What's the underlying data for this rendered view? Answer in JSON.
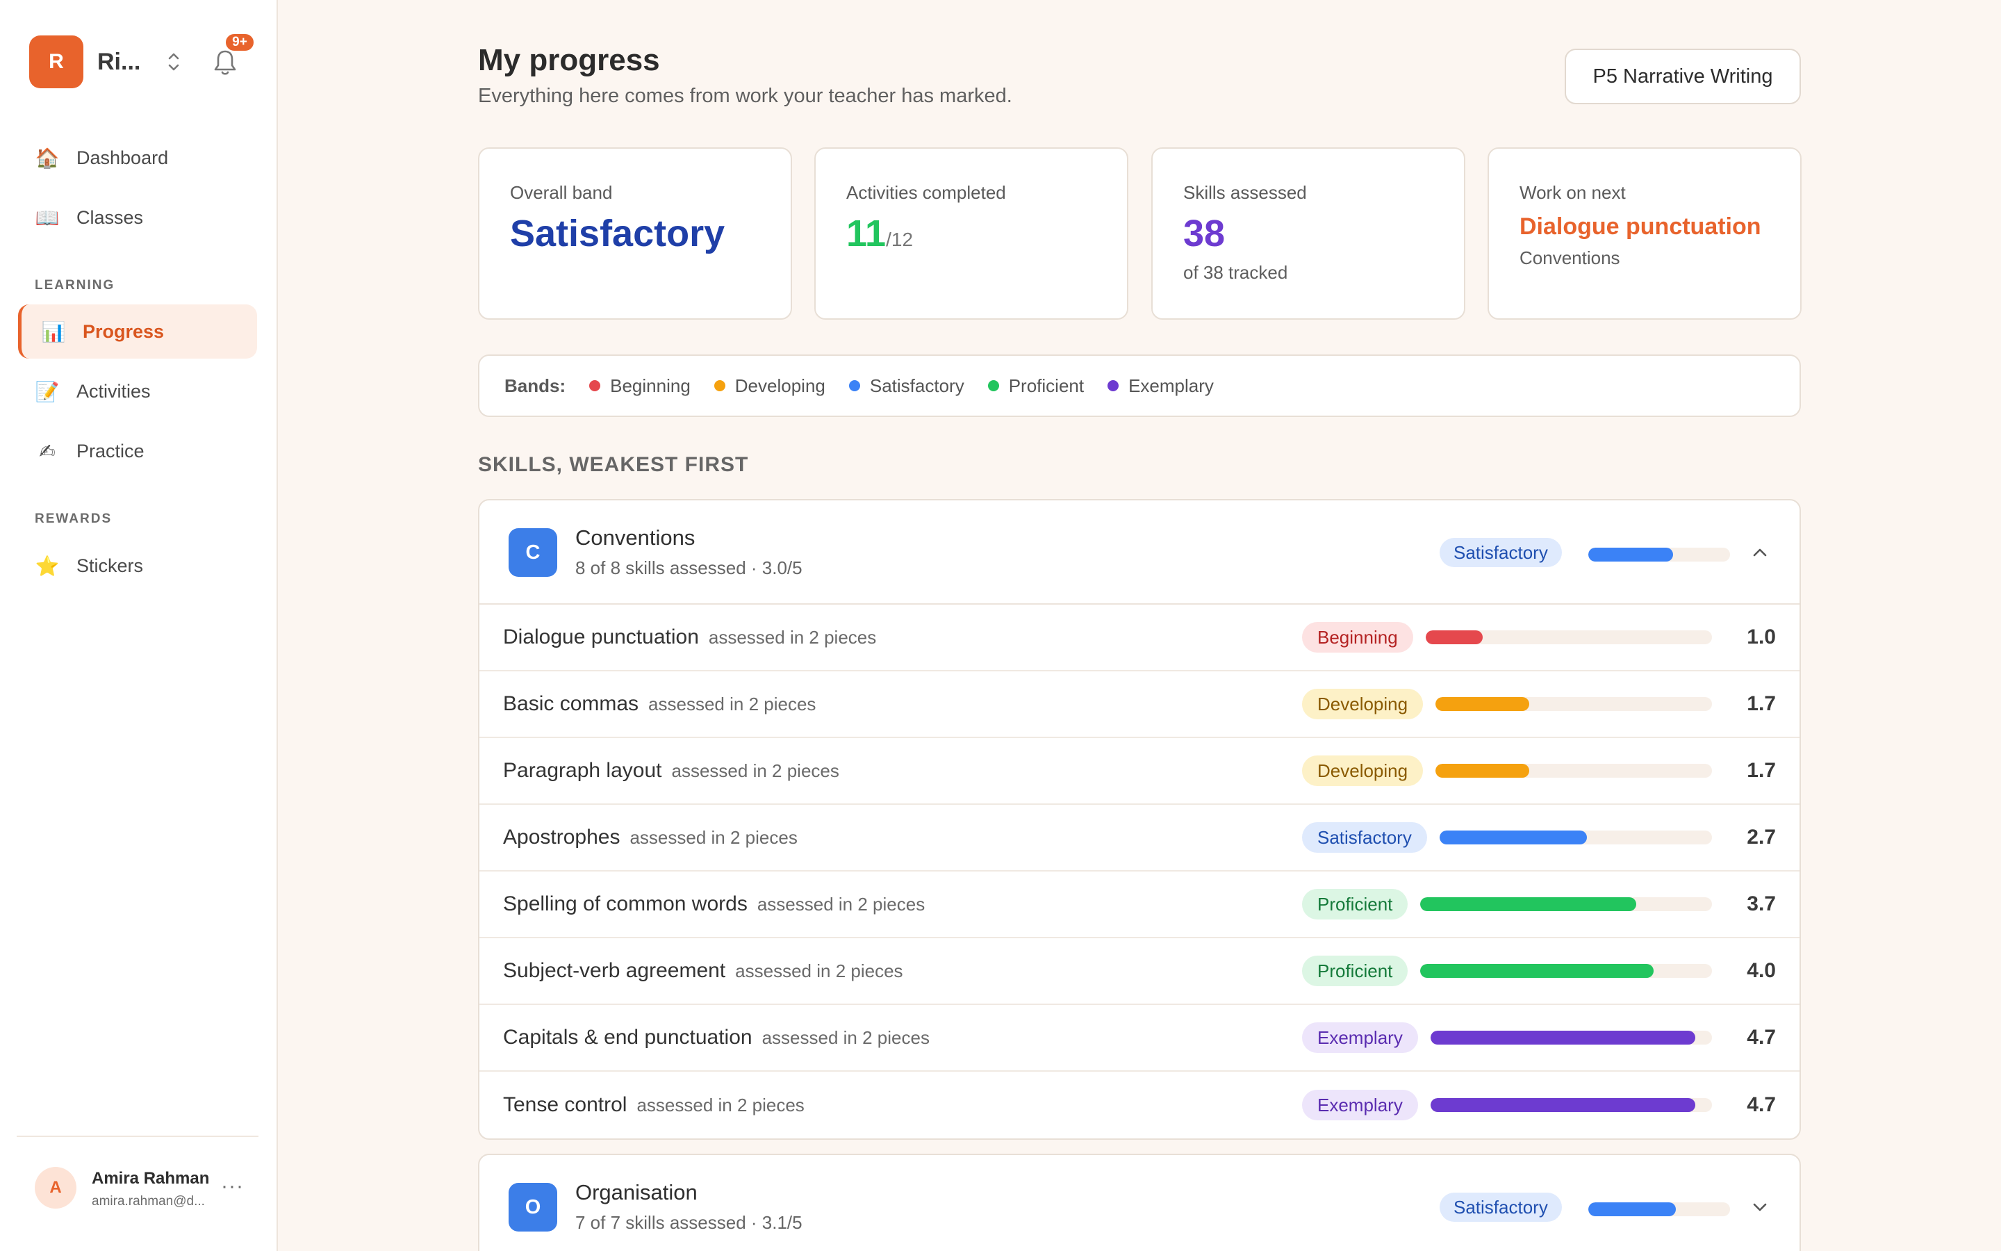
{
  "app": {
    "logo_letter": "R",
    "name": "Ri...",
    "notification_badge": "9+"
  },
  "nav": {
    "items": [
      {
        "label": "Dashboard",
        "icon": "🏠",
        "icon_name": "house-icon"
      },
      {
        "label": "Classes",
        "icon": "📖",
        "icon_name": "book-icon"
      }
    ],
    "learning_label": "LEARNING",
    "learning_items": [
      {
        "label": "Progress",
        "icon": "📊",
        "icon_name": "bar-chart-icon",
        "active": true
      },
      {
        "label": "Activities",
        "icon": "📝",
        "icon_name": "memo-icon"
      },
      {
        "label": "Practice",
        "icon": "✍",
        "icon_name": "writing-hand-icon"
      }
    ],
    "rewards_label": "REWARDS",
    "rewards_items": [
      {
        "label": "Stickers",
        "icon": "⭐",
        "icon_name": "star-icon"
      }
    ]
  },
  "user": {
    "initial": "A",
    "name": "Amira Rahman",
    "email": "amira.rahman@d...",
    "more": "···"
  },
  "page": {
    "title": "My progress",
    "subtitle": "Everything here comes from work your teacher has marked.",
    "class_selector": "P5 Narrative Writing"
  },
  "stats": {
    "overall": {
      "label": "Overall band",
      "value": "Satisfactory"
    },
    "activities": {
      "label": "Activities completed",
      "value": "11",
      "total": "/12"
    },
    "skills": {
      "label": "Skills assessed",
      "value": "38",
      "sub": "of 38 tracked"
    },
    "next": {
      "label": "Work on next",
      "value": "Dialogue punctuation",
      "sub": "Conventions"
    }
  },
  "bands_legend": {
    "label": "Bands:",
    "items": [
      {
        "name": "Beginning",
        "color": "#e5484d"
      },
      {
        "name": "Developing",
        "color": "#f5a10f"
      },
      {
        "name": "Satisfactory",
        "color": "#3b82f6"
      },
      {
        "name": "Proficient",
        "color": "#22c55e"
      },
      {
        "name": "Exemplary",
        "color": "#6d3bd0"
      }
    ]
  },
  "skills_heading": "SKILLS, WEAKEST FIRST",
  "groups": [
    {
      "icon": "C",
      "name": "Conventions",
      "meta": "8 of 8 skills assessed · 3.0/5",
      "band": "Satisfactory",
      "score": 3.0,
      "expanded": true,
      "skills": [
        {
          "name": "Dialogue punctuation",
          "meta": "assessed in 2 pieces",
          "band": "Beginning",
          "score": "1.0"
        },
        {
          "name": "Basic commas",
          "meta": "assessed in 2 pieces",
          "band": "Developing",
          "score": "1.7"
        },
        {
          "name": "Paragraph layout",
          "meta": "assessed in 2 pieces",
          "band": "Developing",
          "score": "1.7"
        },
        {
          "name": "Apostrophes",
          "meta": "assessed in 2 pieces",
          "band": "Satisfactory",
          "score": "2.7"
        },
        {
          "name": "Spelling of common words",
          "meta": "assessed in 2 pieces",
          "band": "Proficient",
          "score": "3.7"
        },
        {
          "name": "Subject-verb agreement",
          "meta": "assessed in 2 pieces",
          "band": "Proficient",
          "score": "4.0"
        },
        {
          "name": "Capitals & end punctuation",
          "meta": "assessed in 2 pieces",
          "band": "Exemplary",
          "score": "4.7"
        },
        {
          "name": "Tense control",
          "meta": "assessed in 2 pieces",
          "band": "Exemplary",
          "score": "4.7"
        }
      ]
    },
    {
      "icon": "O",
      "name": "Organisation",
      "meta": "7 of 7 skills assessed · 3.1/5",
      "band": "Satisfactory",
      "score": 3.1,
      "expanded": false,
      "skills": []
    }
  ],
  "band_styles": {
    "Beginning": {
      "bg": "#fde2e2",
      "fg": "#b42323",
      "bar": "#e5484d"
    },
    "Developing": {
      "bg": "#fdf1c7",
      "fg": "#8a5a00",
      "bar": "#f5a10f"
    },
    "Satisfactory": {
      "bg": "#dfeafd",
      "fg": "#1f4fb0",
      "bar": "#3b82f6"
    },
    "Proficient": {
      "bg": "#dcf6e4",
      "fg": "#157a3a",
      "bar": "#22c55e"
    },
    "Exemplary": {
      "bg": "#ede5fb",
      "fg": "#5a2cb0",
      "bar": "#6d3bd0"
    }
  },
  "colors": {
    "accent": "#e8632c",
    "overall_value": "#1f3fa8",
    "activities_value": "#22c55e",
    "skills_value": "#6d3bd0",
    "next_value": "#e8632c"
  }
}
